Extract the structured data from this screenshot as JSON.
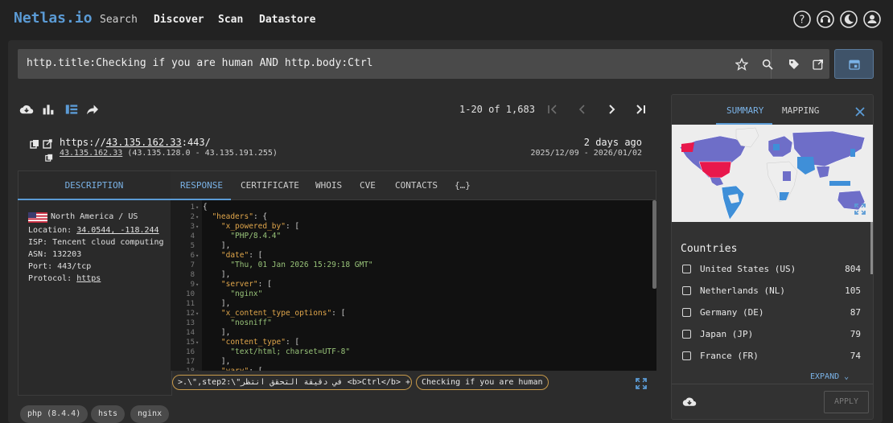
{
  "nav": {
    "logo": "Netlas.io",
    "links": [
      "Search",
      "Discover",
      "Scan",
      "Datastore"
    ],
    "icons": [
      "help-icon",
      "support-icon",
      "theme-toggle-icon",
      "account-icon"
    ]
  },
  "search": {
    "query": "http.title:Checking if you are human AND http.body:Ctrl",
    "icons": [
      "star-icon",
      "search-icon",
      "tag-icon",
      "share-icon",
      "calendar-icon"
    ]
  },
  "toolbar": {
    "icons": [
      "download-icon",
      "chart-icon",
      "list-view-icon",
      "share-arrow-icon"
    ],
    "pager": "1-20 of 1,683"
  },
  "result": {
    "url_prefix": "https://",
    "url_host": "43.135.162.33",
    "url_suffix": ":443/",
    "ip": "43.135.162.33",
    "range": "(43.135.128.0 - 43.135.191.255)",
    "ago": "2 days ago",
    "dates": "2025/12/09 - 2026/01/02"
  },
  "description": {
    "tab": "DESCRIPTION",
    "region": "North America / US",
    "location_label": "Location: ",
    "location_value": "34.0544, -118.244",
    "isp": "ISP: Tencent cloud computing",
    "asn": "ASN: 132203",
    "port": "Port: 443/tcp",
    "protocol_label": "Protocol: ",
    "protocol_value": "https"
  },
  "tabs": [
    "RESPONSE",
    "CERTIFICATE",
    "WHOIS",
    "CVE",
    "CONTACTS",
    "{…}"
  ],
  "code_lines": [
    {
      "n": "1",
      "fold": true,
      "t": "{"
    },
    {
      "n": "2",
      "fold": true,
      "t": "  \"headers\": {"
    },
    {
      "n": "3",
      "fold": true,
      "t": "    \"x_powered_by\": ["
    },
    {
      "n": "4",
      "fold": false,
      "t": "      \"PHP/8.4.4\""
    },
    {
      "n": "5",
      "fold": false,
      "t": "    ],"
    },
    {
      "n": "6",
      "fold": true,
      "t": "    \"date\": ["
    },
    {
      "n": "7",
      "fold": false,
      "t": "      \"Thu, 01 Jan 2026 15:29:18 GMT\""
    },
    {
      "n": "8",
      "fold": false,
      "t": "    ],"
    },
    {
      "n": "9",
      "fold": true,
      "t": "    \"server\": ["
    },
    {
      "n": "10",
      "fold": false,
      "t": "      \"nginx\""
    },
    {
      "n": "11",
      "fold": false,
      "t": "    ],"
    },
    {
      "n": "12",
      "fold": true,
      "t": "    \"x_content_type_options\": ["
    },
    {
      "n": "13",
      "fold": false,
      "t": "      \"nosniff\""
    },
    {
      "n": "14",
      "fold": false,
      "t": "    ],"
    },
    {
      "n": "15",
      "fold": true,
      "t": "    \"content_type\": ["
    },
    {
      "n": "16",
      "fold": false,
      "t": "      \"text/html; charset=UTF-8\""
    },
    {
      "n": "17",
      "fold": false,
      "t": "    ],"
    },
    {
      "n": "18",
      "fold": true,
      "t": "    \"vary\": ["
    }
  ],
  "highlights": [
    ">.\\\",step2:\\\"في دقيقة التحقق انتظر <b>Ctrl</b> + <b>V</b",
    "Checking if you are human"
  ],
  "tags": [
    "php (8.4.4)",
    "hsts",
    "nginx"
  ],
  "right_panel": {
    "tabs": [
      "SUMMARY",
      "MAPPING"
    ],
    "countries_title": "Countries",
    "countries": [
      {
        "name": "United States (US)",
        "count": "804"
      },
      {
        "name": "Netherlands (NL)",
        "count": "105"
      },
      {
        "name": "Germany (DE)",
        "count": "87"
      },
      {
        "name": "Japan (JP)",
        "count": "79"
      },
      {
        "name": "France (FR)",
        "count": "74"
      }
    ],
    "expand": "EXPAND",
    "apply": "APPLY"
  },
  "colors": {
    "accent": "#5b9bd5",
    "highlight_border": "#c89a4a",
    "map_us": "#e8184c",
    "map_primary": "#6e6ec8",
    "map_secondary": "#3f8fd8"
  }
}
